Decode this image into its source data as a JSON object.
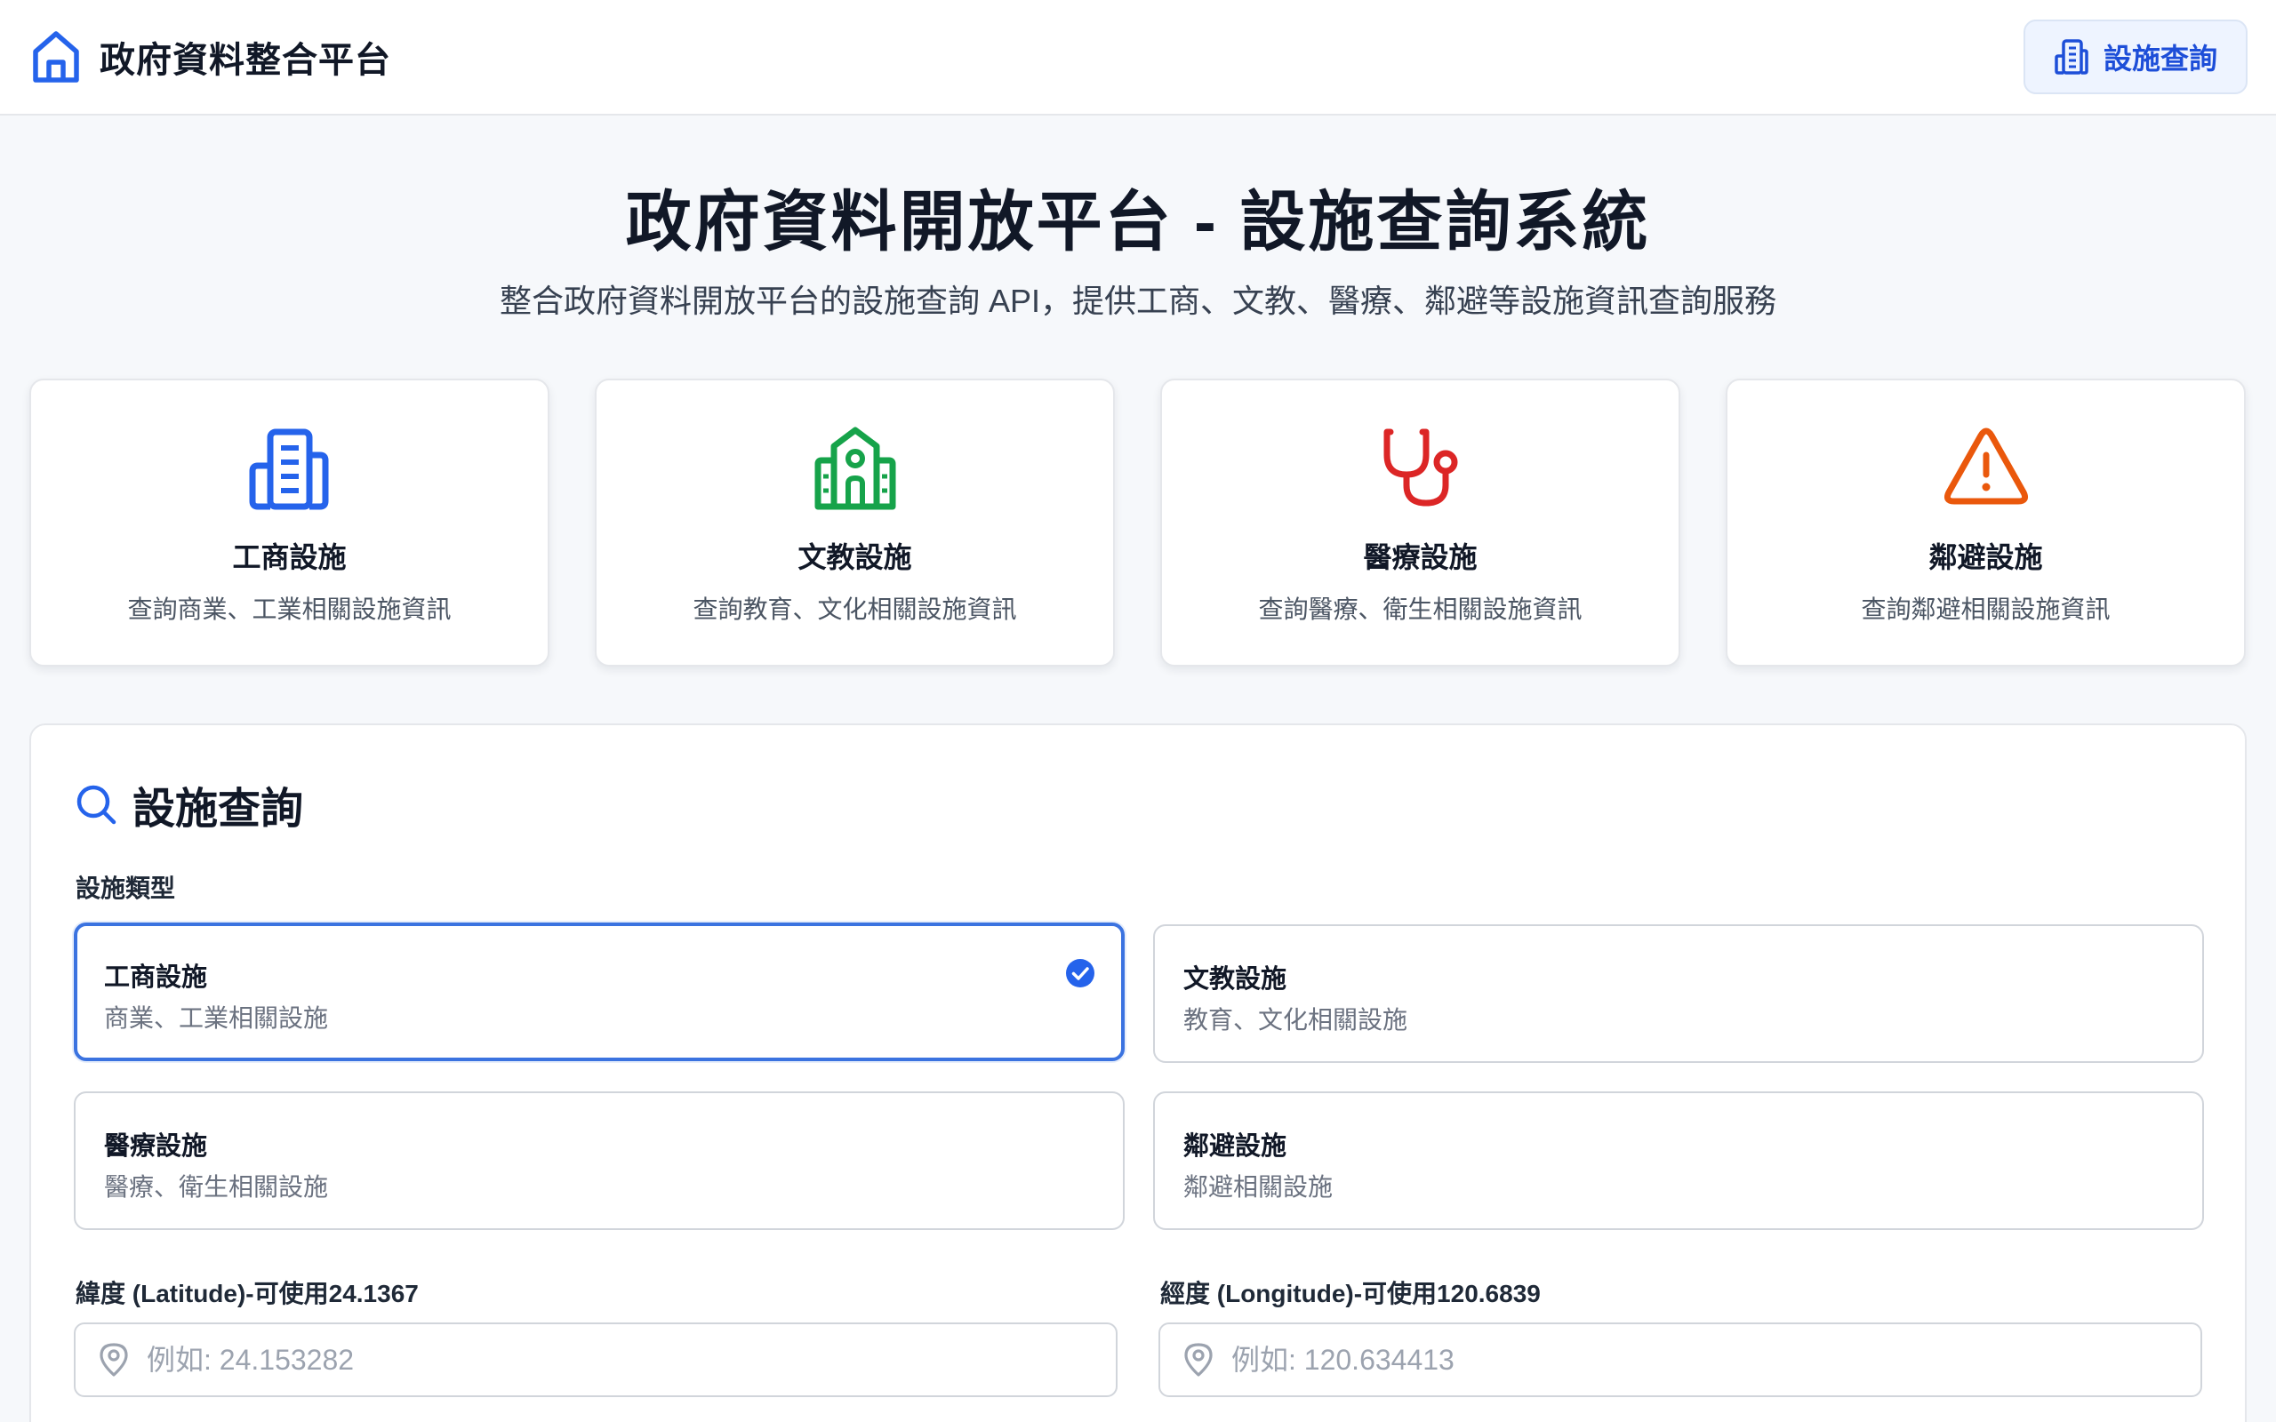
{
  "header": {
    "brand_icon": "home-icon",
    "title": "政府資料整合平台",
    "nav_button_icon": "building-icon",
    "nav_button_label": "設施查詢",
    "accent_color": "#1d4ed8"
  },
  "hero": {
    "title": "政府資料開放平台 - 設施查詢系統",
    "subtitle": "整合政府資料開放平台的設施查詢 API，提供工商、文教、醫療、鄰避等設施資訊查詢服務"
  },
  "categories": [
    {
      "icon": "building-icon",
      "color": "#2563eb",
      "title": "工商設施",
      "desc": "查詢商業、工業相關設施資訊"
    },
    {
      "icon": "school-icon",
      "color": "#16a34a",
      "title": "文教設施",
      "desc": "查詢教育、文化相關設施資訊"
    },
    {
      "icon": "stethoscope-icon",
      "color": "#dc2626",
      "title": "醫療設施",
      "desc": "查詢醫療、衛生相關設施資訊"
    },
    {
      "icon": "warning-icon",
      "color": "#ea580c",
      "title": "鄰避設施",
      "desc": "查詢鄰避相關設施資訊"
    }
  ],
  "search": {
    "icon": "search-icon",
    "title": "設施查詢",
    "type_label": "設施類型",
    "options": [
      {
        "title": "工商設施",
        "desc": "商業、工業相關設施",
        "selected": true
      },
      {
        "title": "文教設施",
        "desc": "教育、文化相關設施",
        "selected": false
      },
      {
        "title": "醫療設施",
        "desc": "醫療、衛生相關設施",
        "selected": false
      },
      {
        "title": "鄰避設施",
        "desc": "鄰避相關設施",
        "selected": false
      }
    ],
    "latitude": {
      "label": "緯度 (Latitude)-可使用24.1367",
      "value": "",
      "placeholder": "例如: 24.153282",
      "icon": "map-pin-icon"
    },
    "longitude": {
      "label": "經度 (Longitude)-可使用120.6839",
      "value": "",
      "placeholder": "例如: 120.634413",
      "icon": "map-pin-icon"
    }
  }
}
